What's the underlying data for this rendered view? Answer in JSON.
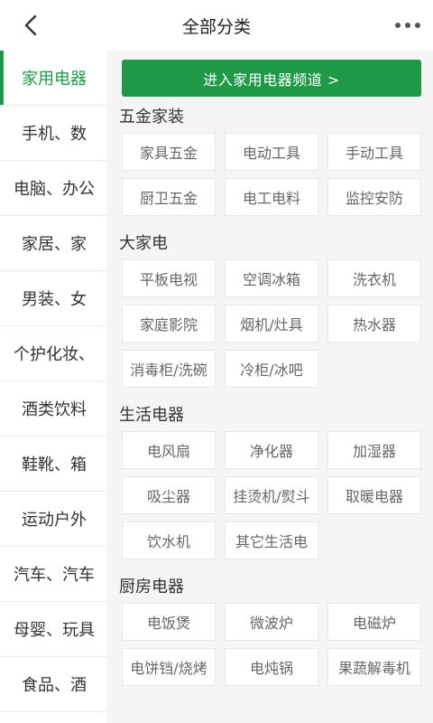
{
  "header": {
    "title": "全部分类"
  },
  "sidebar": {
    "items": [
      {
        "label": "家用电器"
      },
      {
        "label": "手机、数"
      },
      {
        "label": "电脑、办公"
      },
      {
        "label": "家居、家"
      },
      {
        "label": "男装、女"
      },
      {
        "label": "个护化妆、"
      },
      {
        "label": "酒类饮料"
      },
      {
        "label": "鞋靴、箱"
      },
      {
        "label": "运动户外"
      },
      {
        "label": "汽车、汽车"
      },
      {
        "label": "母婴、玩具"
      },
      {
        "label": "食品、酒"
      }
    ],
    "active_index": 0
  },
  "main": {
    "channel_button": "进入家用电器频道 >",
    "sections": [
      {
        "title": "五金家装",
        "items": [
          "家具五金",
          "电动工具",
          "手动工具",
          "厨卫五金",
          "电工电料",
          "监控安防"
        ]
      },
      {
        "title": "大家电",
        "items": [
          "平板电视",
          "空调冰箱",
          "洗衣机",
          "家庭影院",
          "烟机/灶具",
          "热水器",
          "消毒柜/洗碗",
          "冷柜/冰吧"
        ]
      },
      {
        "title": "生活电器",
        "items": [
          "电风扇",
          "净化器",
          "加湿器",
          "吸尘器",
          "挂烫机/熨斗",
          "取暖电器",
          "饮水机",
          "其它生活电"
        ]
      },
      {
        "title": "厨房电器",
        "items": [
          "电饭煲",
          "微波炉",
          "电磁炉",
          "电饼铛/烧烤",
          "电炖锅",
          "果蔬解毒机"
        ]
      }
    ]
  },
  "colors": {
    "accent": "#1e9a47",
    "chip_text": "#666666",
    "content_bg": "#f5f5f5"
  }
}
